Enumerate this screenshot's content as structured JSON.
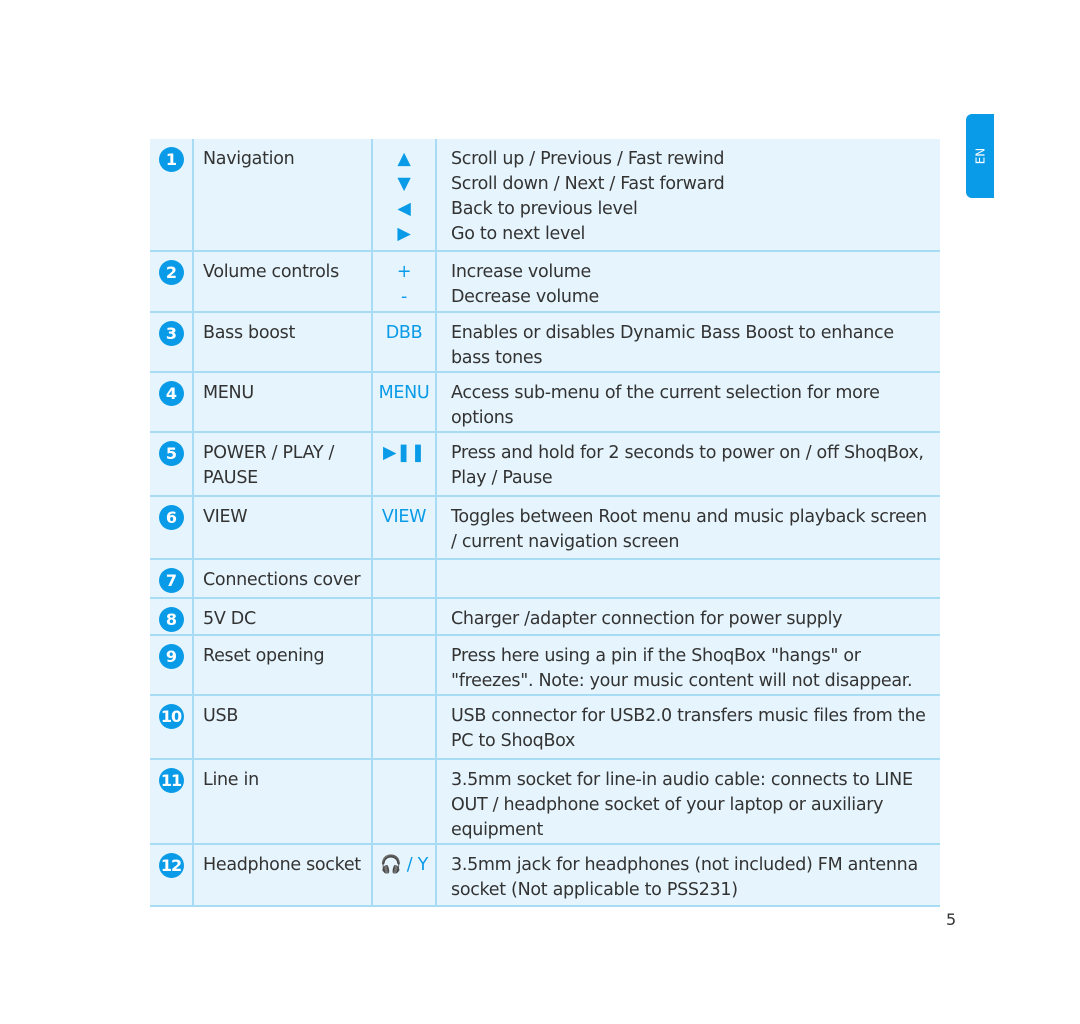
{
  "tab": "EN",
  "page_number": "5",
  "accent": "#0a9be8",
  "rows": [
    {
      "n": "1",
      "name": "Navigation",
      "symbols": [
        "▲",
        "▼",
        "◀",
        "▶"
      ],
      "desc": [
        "Scroll up / Previous / Fast rewind",
        "Scroll down / Next / Fast forward",
        "Back to previous level",
        "Go to next level"
      ]
    },
    {
      "n": "2",
      "name": "Volume controls",
      "symbols": [
        "+",
        "-"
      ],
      "desc": [
        "Increase volume",
        "Decrease volume"
      ]
    },
    {
      "n": "3",
      "name": "Bass boost",
      "symbols": [
        "DBB"
      ],
      "desc": [
        "Enables or disables Dynamic Bass Boost to enhance bass tones"
      ]
    },
    {
      "n": "4",
      "name": "MENU",
      "symbols": [
        "MENU"
      ],
      "desc": [
        "Access sub-menu of the current selection for more options"
      ]
    },
    {
      "n": "5",
      "name": "POWER / PLAY / PAUSE",
      "symbols": [
        "▶❚❚"
      ],
      "desc": [
        "Press and hold for 2 seconds to power on / off ShoqBox, Play / Pause"
      ]
    },
    {
      "n": "6",
      "name": "VIEW",
      "symbols": [
        "VIEW"
      ],
      "desc": [
        "Toggles between Root menu and music playback screen / current navigation screen"
      ]
    },
    {
      "n": "7",
      "name": "Connections cover",
      "symbols": [],
      "desc": []
    },
    {
      "n": "8",
      "name": "5V DC",
      "symbols": [],
      "desc": [
        "Charger /adapter connection for power supply"
      ]
    },
    {
      "n": "9",
      "name": "Reset opening",
      "symbols": [],
      "desc": [
        "Press here using a pin if the ShoqBox \"hangs\" or \"freezes\". Note: your music content will not disappear."
      ]
    },
    {
      "n": "10",
      "name": "USB",
      "symbols": [],
      "desc": [
        "USB connector for USB2.0 transfers music files from the PC to ShoqBox"
      ]
    },
    {
      "n": "11",
      "name": "Line in",
      "symbols": [],
      "desc": [
        "3.5mm socket for line-in audio cable: connects to LINE OUT / headphone socket of your laptop or auxiliary equipment"
      ]
    },
    {
      "n": "12",
      "name": "Headphone socket",
      "symbols": [
        "🎧 / Y"
      ],
      "desc": [
        "3.5mm jack for headphones (not included) FM antenna socket (Not applicable to PSS231)"
      ]
    }
  ]
}
